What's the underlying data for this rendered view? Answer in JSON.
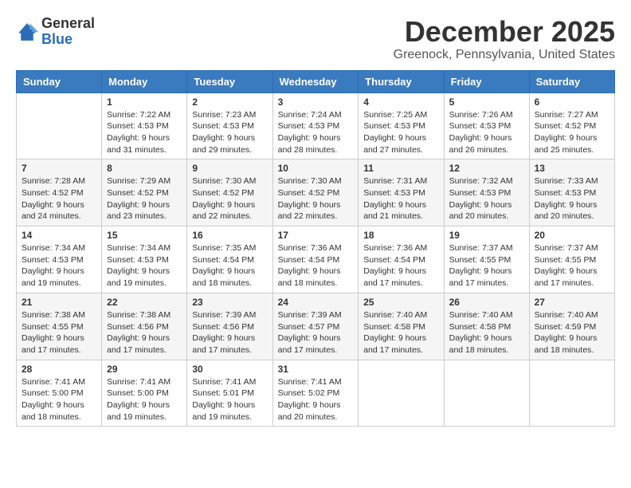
{
  "logo": {
    "general": "General",
    "blue": "Blue"
  },
  "title": "December 2025",
  "location": "Greenock, Pennsylvania, United States",
  "days_of_week": [
    "Sunday",
    "Monday",
    "Tuesday",
    "Wednesday",
    "Thursday",
    "Friday",
    "Saturday"
  ],
  "weeks": [
    [
      {
        "day": "",
        "sunrise": "",
        "sunset": "",
        "daylight": ""
      },
      {
        "day": "1",
        "sunrise": "Sunrise: 7:22 AM",
        "sunset": "Sunset: 4:53 PM",
        "daylight": "Daylight: 9 hours and 31 minutes."
      },
      {
        "day": "2",
        "sunrise": "Sunrise: 7:23 AM",
        "sunset": "Sunset: 4:53 PM",
        "daylight": "Daylight: 9 hours and 29 minutes."
      },
      {
        "day": "3",
        "sunrise": "Sunrise: 7:24 AM",
        "sunset": "Sunset: 4:53 PM",
        "daylight": "Daylight: 9 hours and 28 minutes."
      },
      {
        "day": "4",
        "sunrise": "Sunrise: 7:25 AM",
        "sunset": "Sunset: 4:53 PM",
        "daylight": "Daylight: 9 hours and 27 minutes."
      },
      {
        "day": "5",
        "sunrise": "Sunrise: 7:26 AM",
        "sunset": "Sunset: 4:53 PM",
        "daylight": "Daylight: 9 hours and 26 minutes."
      },
      {
        "day": "6",
        "sunrise": "Sunrise: 7:27 AM",
        "sunset": "Sunset: 4:52 PM",
        "daylight": "Daylight: 9 hours and 25 minutes."
      }
    ],
    [
      {
        "day": "7",
        "sunrise": "Sunrise: 7:28 AM",
        "sunset": "Sunset: 4:52 PM",
        "daylight": "Daylight: 9 hours and 24 minutes."
      },
      {
        "day": "8",
        "sunrise": "Sunrise: 7:29 AM",
        "sunset": "Sunset: 4:52 PM",
        "daylight": "Daylight: 9 hours and 23 minutes."
      },
      {
        "day": "9",
        "sunrise": "Sunrise: 7:30 AM",
        "sunset": "Sunset: 4:52 PM",
        "daylight": "Daylight: 9 hours and 22 minutes."
      },
      {
        "day": "10",
        "sunrise": "Sunrise: 7:30 AM",
        "sunset": "Sunset: 4:52 PM",
        "daylight": "Daylight: 9 hours and 22 minutes."
      },
      {
        "day": "11",
        "sunrise": "Sunrise: 7:31 AM",
        "sunset": "Sunset: 4:53 PM",
        "daylight": "Daylight: 9 hours and 21 minutes."
      },
      {
        "day": "12",
        "sunrise": "Sunrise: 7:32 AM",
        "sunset": "Sunset: 4:53 PM",
        "daylight": "Daylight: 9 hours and 20 minutes."
      },
      {
        "day": "13",
        "sunrise": "Sunrise: 7:33 AM",
        "sunset": "Sunset: 4:53 PM",
        "daylight": "Daylight: 9 hours and 20 minutes."
      }
    ],
    [
      {
        "day": "14",
        "sunrise": "Sunrise: 7:34 AM",
        "sunset": "Sunset: 4:53 PM",
        "daylight": "Daylight: 9 hours and 19 minutes."
      },
      {
        "day": "15",
        "sunrise": "Sunrise: 7:34 AM",
        "sunset": "Sunset: 4:53 PM",
        "daylight": "Daylight: 9 hours and 19 minutes."
      },
      {
        "day": "16",
        "sunrise": "Sunrise: 7:35 AM",
        "sunset": "Sunset: 4:54 PM",
        "daylight": "Daylight: 9 hours and 18 minutes."
      },
      {
        "day": "17",
        "sunrise": "Sunrise: 7:36 AM",
        "sunset": "Sunset: 4:54 PM",
        "daylight": "Daylight: 9 hours and 18 minutes."
      },
      {
        "day": "18",
        "sunrise": "Sunrise: 7:36 AM",
        "sunset": "Sunset: 4:54 PM",
        "daylight": "Daylight: 9 hours and 17 minutes."
      },
      {
        "day": "19",
        "sunrise": "Sunrise: 7:37 AM",
        "sunset": "Sunset: 4:55 PM",
        "daylight": "Daylight: 9 hours and 17 minutes."
      },
      {
        "day": "20",
        "sunrise": "Sunrise: 7:37 AM",
        "sunset": "Sunset: 4:55 PM",
        "daylight": "Daylight: 9 hours and 17 minutes."
      }
    ],
    [
      {
        "day": "21",
        "sunrise": "Sunrise: 7:38 AM",
        "sunset": "Sunset: 4:55 PM",
        "daylight": "Daylight: 9 hours and 17 minutes."
      },
      {
        "day": "22",
        "sunrise": "Sunrise: 7:38 AM",
        "sunset": "Sunset: 4:56 PM",
        "daylight": "Daylight: 9 hours and 17 minutes."
      },
      {
        "day": "23",
        "sunrise": "Sunrise: 7:39 AM",
        "sunset": "Sunset: 4:56 PM",
        "daylight": "Daylight: 9 hours and 17 minutes."
      },
      {
        "day": "24",
        "sunrise": "Sunrise: 7:39 AM",
        "sunset": "Sunset: 4:57 PM",
        "daylight": "Daylight: 9 hours and 17 minutes."
      },
      {
        "day": "25",
        "sunrise": "Sunrise: 7:40 AM",
        "sunset": "Sunset: 4:58 PM",
        "daylight": "Daylight: 9 hours and 17 minutes."
      },
      {
        "day": "26",
        "sunrise": "Sunrise: 7:40 AM",
        "sunset": "Sunset: 4:58 PM",
        "daylight": "Daylight: 9 hours and 18 minutes."
      },
      {
        "day": "27",
        "sunrise": "Sunrise: 7:40 AM",
        "sunset": "Sunset: 4:59 PM",
        "daylight": "Daylight: 9 hours and 18 minutes."
      }
    ],
    [
      {
        "day": "28",
        "sunrise": "Sunrise: 7:41 AM",
        "sunset": "Sunset: 5:00 PM",
        "daylight": "Daylight: 9 hours and 18 minutes."
      },
      {
        "day": "29",
        "sunrise": "Sunrise: 7:41 AM",
        "sunset": "Sunset: 5:00 PM",
        "daylight": "Daylight: 9 hours and 19 minutes."
      },
      {
        "day": "30",
        "sunrise": "Sunrise: 7:41 AM",
        "sunset": "Sunset: 5:01 PM",
        "daylight": "Daylight: 9 hours and 19 minutes."
      },
      {
        "day": "31",
        "sunrise": "Sunrise: 7:41 AM",
        "sunset": "Sunset: 5:02 PM",
        "daylight": "Daylight: 9 hours and 20 minutes."
      },
      {
        "day": "",
        "sunrise": "",
        "sunset": "",
        "daylight": ""
      },
      {
        "day": "",
        "sunrise": "",
        "sunset": "",
        "daylight": ""
      },
      {
        "day": "",
        "sunrise": "",
        "sunset": "",
        "daylight": ""
      }
    ]
  ]
}
